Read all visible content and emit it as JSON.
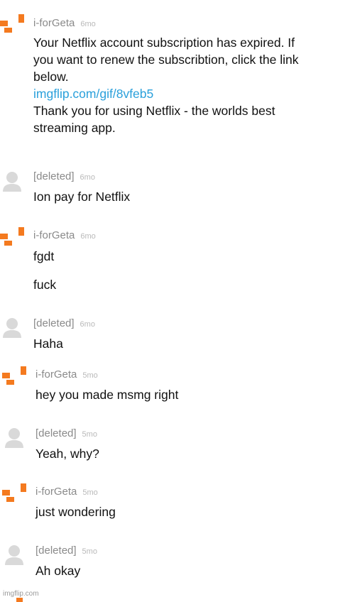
{
  "colors": {
    "brand_orange": "#f47a1f",
    "link_blue": "#2aa0db",
    "username_gray": "#8a8a8a",
    "timestamp_gray": "#b9b9b9",
    "avatar_gray": "#d9d9d9"
  },
  "comments": [
    {
      "username": "i-forGeta",
      "time": "6mo",
      "avatar_icon": "orange-bracket-avatar-icon",
      "lines": [
        "Your Netflix account subscription has expired. If",
        "you want to renew the subscribtion, click the link",
        "below."
      ],
      "link": "imgflip.com/gif/8vfeb5",
      "after_lines": [
        "Thank you for using Netflix - the worlds best",
        "streaming app."
      ]
    },
    {
      "username": "[deleted]",
      "time": "6mo",
      "avatar_icon": "gray-user-avatar-icon",
      "text": "Ion pay for Netflix"
    },
    {
      "username": "i-forGeta",
      "time": "6mo",
      "avatar_icon": "orange-bracket-avatar-icon",
      "text": "fgdt",
      "text2": "fuck"
    },
    {
      "username": "[deleted]",
      "time": "6mo",
      "avatar_icon": "gray-user-avatar-icon",
      "text": "Haha"
    },
    {
      "username": "i-forGeta",
      "time": "5mo",
      "avatar_icon": "orange-bracket-avatar-icon",
      "text": "hey you made msmg right"
    },
    {
      "username": "[deleted]",
      "time": "5mo",
      "avatar_icon": "gray-user-avatar-icon",
      "text": "Yeah, why?"
    },
    {
      "username": "i-forGeta",
      "time": "5mo",
      "avatar_icon": "orange-bracket-avatar-icon",
      "text": "just wondering"
    },
    {
      "username": "[deleted]",
      "time": "5mo",
      "avatar_icon": "gray-user-avatar-icon",
      "text": "Ah okay"
    }
  ],
  "watermark": "imgflip.com"
}
